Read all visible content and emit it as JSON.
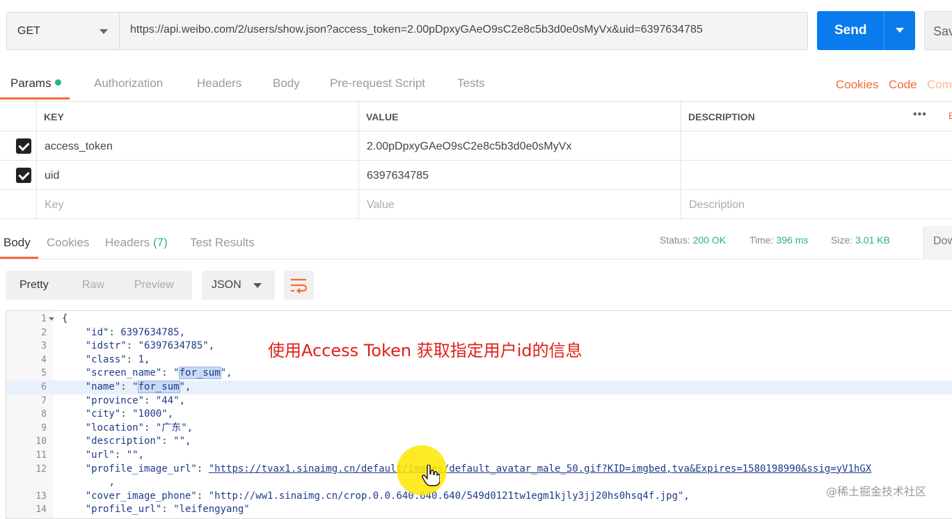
{
  "request": {
    "method": "GET",
    "url": "https://api.weibo.com/2/users/show.json?access_token=2.00pDpxyGAeO9sC2e8c5b3d0e0sMyVx&uid=6397634785",
    "send_label": "Send",
    "save_label": "Sav"
  },
  "request_tabs": {
    "params": "Params",
    "authorization": "Authorization",
    "headers": "Headers",
    "body": "Body",
    "prerequest": "Pre-request Script",
    "tests": "Tests",
    "cookies": "Cookies",
    "code": "Code",
    "comments": "Com"
  },
  "params_table": {
    "columns": [
      "KEY",
      "VALUE",
      "DESCRIPTION"
    ],
    "more": "•••",
    "edge": "B",
    "rows": [
      {
        "checked": true,
        "key": "access_token",
        "value": "2.00pDpxyGAeO9sC2e8c5b3d0e0sMyVx",
        "description": ""
      },
      {
        "checked": true,
        "key": "uid",
        "value": "6397634785",
        "description": ""
      }
    ],
    "placeholder": {
      "key": "Key",
      "value": "Value",
      "description": "Description"
    }
  },
  "response_tabs": {
    "body": "Body",
    "cookies": "Cookies",
    "headers": "Headers",
    "headers_count": "(7)",
    "test_results": "Test Results"
  },
  "response_status": {
    "status_label": "Status:",
    "status_value": "200 OK",
    "time_label": "Time:",
    "time_value": "396 ms",
    "size_label": "Size:",
    "size_value": "3.01 KB",
    "download_label": "Dow"
  },
  "format_toolbar": {
    "pretty": "Pretty",
    "raw": "Raw",
    "preview": "Preview",
    "format": "JSON"
  },
  "code_lines": [
    {
      "n": "1",
      "pre": "{",
      "key": "",
      "mid": "",
      "val": ""
    },
    {
      "n": "2",
      "pre": "    ",
      "key": "\"id\"",
      "mid": ": ",
      "val": "6397634785,"
    },
    {
      "n": "3",
      "pre": "    ",
      "key": "\"idstr\"",
      "mid": ": ",
      "val": "\"6397634785\","
    },
    {
      "n": "4",
      "pre": "    ",
      "key": "\"class\"",
      "mid": ": ",
      "val": "1,"
    },
    {
      "n": "5",
      "pre": "    ",
      "key": "\"screen_name\"",
      "mid": ": ",
      "val": "\"for_sum\","
    },
    {
      "n": "6",
      "pre": "    ",
      "key": "\"name\"",
      "mid": ": ",
      "val": "\"for_sum\","
    },
    {
      "n": "7",
      "pre": "    ",
      "key": "\"province\"",
      "mid": ": ",
      "val": "\"44\","
    },
    {
      "n": "8",
      "pre": "    ",
      "key": "\"city\"",
      "mid": ": ",
      "val": "\"1000\","
    },
    {
      "n": "9",
      "pre": "    ",
      "key": "\"location\"",
      "mid": ": ",
      "val": "\"广东\","
    },
    {
      "n": "10",
      "pre": "    ",
      "key": "\"description\"",
      "mid": ": ",
      "val": "\"\","
    },
    {
      "n": "11",
      "pre": "    ",
      "key": "\"url\"",
      "mid": ": ",
      "val": "\"\","
    },
    {
      "n": "12",
      "pre": "    ",
      "key": "\"profile_image_url\"",
      "mid": ": ",
      "val": "\"https://tvax1.sinaimg.cn/default/images/default_avatar_male_50.gif?KID=imgbed,tva&Expires=1580198990&ssig=yV1hGX"
    },
    {
      "n": "",
      "pre": "        ",
      "key": "",
      "mid": "",
      "val": ","
    },
    {
      "n": "13",
      "pre": "    ",
      "key": "\"cover_image_phone\"",
      "mid": ": ",
      "val": "\"http://ww1.sinaimg.cn/crop.0.0.640.640.640/549d0121tw1egm1kjly3jj20hs0hsq4f.jpg\","
    },
    {
      "n": "14",
      "pre": "    ",
      "key": "\"profile_url\"",
      "mid": ": ",
      "val": "\"leifengyang\""
    }
  ],
  "annotation": "使用Access Token 获取指定用户id的信息",
  "watermark": "@稀土掘金技术社区",
  "colors": {
    "accent_orange": "#f26b3a",
    "send_blue": "#097bed",
    "status_green": "#26b47f",
    "annotation_red": "#e0201a"
  }
}
